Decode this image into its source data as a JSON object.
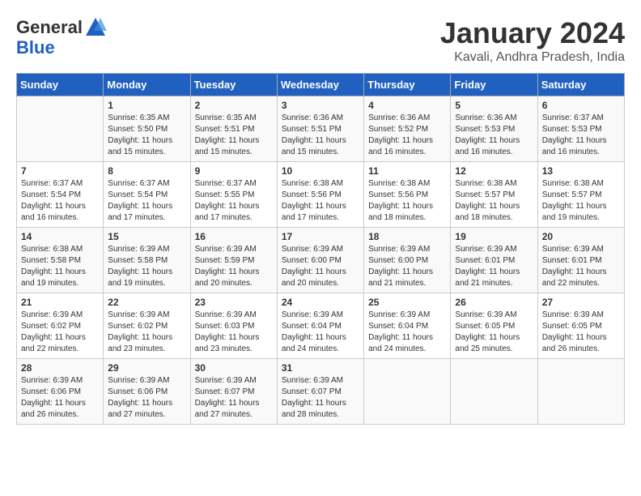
{
  "header": {
    "logo_general": "General",
    "logo_blue": "Blue",
    "month_year": "January 2024",
    "location": "Kavali, Andhra Pradesh, India"
  },
  "days_of_week": [
    "Sunday",
    "Monday",
    "Tuesday",
    "Wednesday",
    "Thursday",
    "Friday",
    "Saturday"
  ],
  "weeks": [
    [
      {
        "num": "",
        "info": ""
      },
      {
        "num": "1",
        "info": "Sunrise: 6:35 AM\nSunset: 5:50 PM\nDaylight: 11 hours\nand 15 minutes."
      },
      {
        "num": "2",
        "info": "Sunrise: 6:35 AM\nSunset: 5:51 PM\nDaylight: 11 hours\nand 15 minutes."
      },
      {
        "num": "3",
        "info": "Sunrise: 6:36 AM\nSunset: 5:51 PM\nDaylight: 11 hours\nand 15 minutes."
      },
      {
        "num": "4",
        "info": "Sunrise: 6:36 AM\nSunset: 5:52 PM\nDaylight: 11 hours\nand 16 minutes."
      },
      {
        "num": "5",
        "info": "Sunrise: 6:36 AM\nSunset: 5:53 PM\nDaylight: 11 hours\nand 16 minutes."
      },
      {
        "num": "6",
        "info": "Sunrise: 6:37 AM\nSunset: 5:53 PM\nDaylight: 11 hours\nand 16 minutes."
      }
    ],
    [
      {
        "num": "7",
        "info": "Sunrise: 6:37 AM\nSunset: 5:54 PM\nDaylight: 11 hours\nand 16 minutes."
      },
      {
        "num": "8",
        "info": "Sunrise: 6:37 AM\nSunset: 5:54 PM\nDaylight: 11 hours\nand 17 minutes."
      },
      {
        "num": "9",
        "info": "Sunrise: 6:37 AM\nSunset: 5:55 PM\nDaylight: 11 hours\nand 17 minutes."
      },
      {
        "num": "10",
        "info": "Sunrise: 6:38 AM\nSunset: 5:56 PM\nDaylight: 11 hours\nand 17 minutes."
      },
      {
        "num": "11",
        "info": "Sunrise: 6:38 AM\nSunset: 5:56 PM\nDaylight: 11 hours\nand 18 minutes."
      },
      {
        "num": "12",
        "info": "Sunrise: 6:38 AM\nSunset: 5:57 PM\nDaylight: 11 hours\nand 18 minutes."
      },
      {
        "num": "13",
        "info": "Sunrise: 6:38 AM\nSunset: 5:57 PM\nDaylight: 11 hours\nand 19 minutes."
      }
    ],
    [
      {
        "num": "14",
        "info": "Sunrise: 6:38 AM\nSunset: 5:58 PM\nDaylight: 11 hours\nand 19 minutes."
      },
      {
        "num": "15",
        "info": "Sunrise: 6:39 AM\nSunset: 5:58 PM\nDaylight: 11 hours\nand 19 minutes."
      },
      {
        "num": "16",
        "info": "Sunrise: 6:39 AM\nSunset: 5:59 PM\nDaylight: 11 hours\nand 20 minutes."
      },
      {
        "num": "17",
        "info": "Sunrise: 6:39 AM\nSunset: 6:00 PM\nDaylight: 11 hours\nand 20 minutes."
      },
      {
        "num": "18",
        "info": "Sunrise: 6:39 AM\nSunset: 6:00 PM\nDaylight: 11 hours\nand 21 minutes."
      },
      {
        "num": "19",
        "info": "Sunrise: 6:39 AM\nSunset: 6:01 PM\nDaylight: 11 hours\nand 21 minutes."
      },
      {
        "num": "20",
        "info": "Sunrise: 6:39 AM\nSunset: 6:01 PM\nDaylight: 11 hours\nand 22 minutes."
      }
    ],
    [
      {
        "num": "21",
        "info": "Sunrise: 6:39 AM\nSunset: 6:02 PM\nDaylight: 11 hours\nand 22 minutes."
      },
      {
        "num": "22",
        "info": "Sunrise: 6:39 AM\nSunset: 6:02 PM\nDaylight: 11 hours\nand 23 minutes."
      },
      {
        "num": "23",
        "info": "Sunrise: 6:39 AM\nSunset: 6:03 PM\nDaylight: 11 hours\nand 23 minutes."
      },
      {
        "num": "24",
        "info": "Sunrise: 6:39 AM\nSunset: 6:04 PM\nDaylight: 11 hours\nand 24 minutes."
      },
      {
        "num": "25",
        "info": "Sunrise: 6:39 AM\nSunset: 6:04 PM\nDaylight: 11 hours\nand 24 minutes."
      },
      {
        "num": "26",
        "info": "Sunrise: 6:39 AM\nSunset: 6:05 PM\nDaylight: 11 hours\nand 25 minutes."
      },
      {
        "num": "27",
        "info": "Sunrise: 6:39 AM\nSunset: 6:05 PM\nDaylight: 11 hours\nand 26 minutes."
      }
    ],
    [
      {
        "num": "28",
        "info": "Sunrise: 6:39 AM\nSunset: 6:06 PM\nDaylight: 11 hours\nand 26 minutes."
      },
      {
        "num": "29",
        "info": "Sunrise: 6:39 AM\nSunset: 6:06 PM\nDaylight: 11 hours\nand 27 minutes."
      },
      {
        "num": "30",
        "info": "Sunrise: 6:39 AM\nSunset: 6:07 PM\nDaylight: 11 hours\nand 27 minutes."
      },
      {
        "num": "31",
        "info": "Sunrise: 6:39 AM\nSunset: 6:07 PM\nDaylight: 11 hours\nand 28 minutes."
      },
      {
        "num": "",
        "info": ""
      },
      {
        "num": "",
        "info": ""
      },
      {
        "num": "",
        "info": ""
      }
    ]
  ]
}
